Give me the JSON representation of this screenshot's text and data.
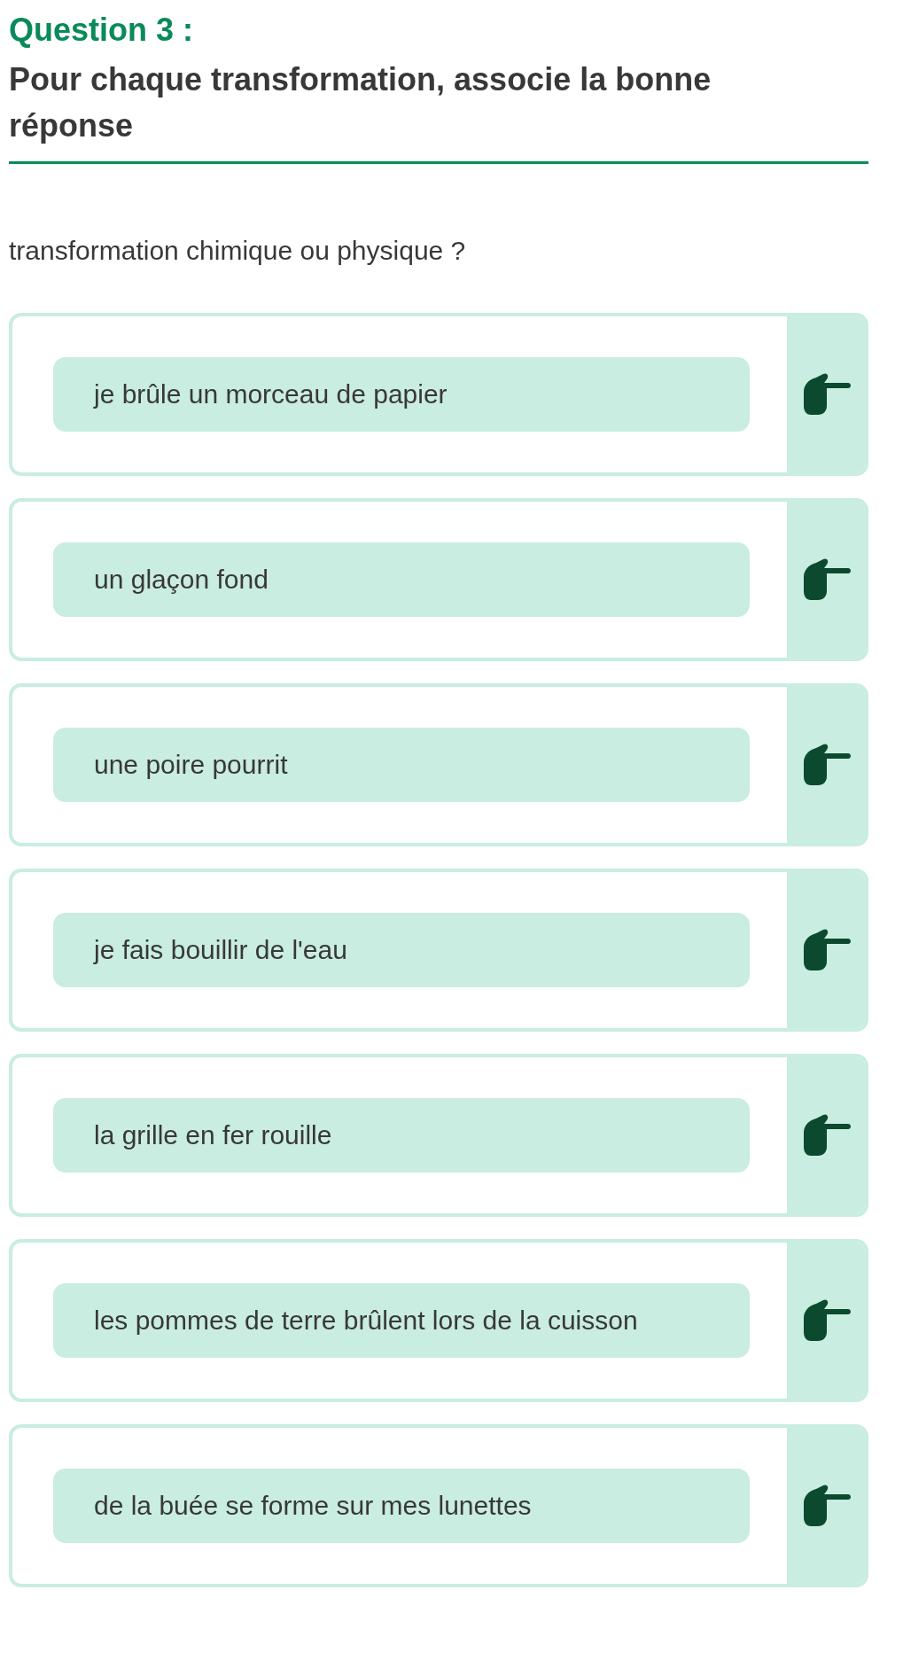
{
  "question_label": "Question 3 :",
  "instruction": "Pour chaque transformation, associe la bonne réponse",
  "prompt": "transformation chimique ou physique ?",
  "items": [
    {
      "text": "je brûle un morceau de papier"
    },
    {
      "text": "un glaçon fond"
    },
    {
      "text": "une poire pourrit"
    },
    {
      "text": "je fais bouillir de l'eau"
    },
    {
      "text": "la grille en fer rouille"
    },
    {
      "text": "les pommes de terre brûlent lors de la cuisson"
    },
    {
      "text": "de la buée se forme sur mes lunettes"
    }
  ]
}
